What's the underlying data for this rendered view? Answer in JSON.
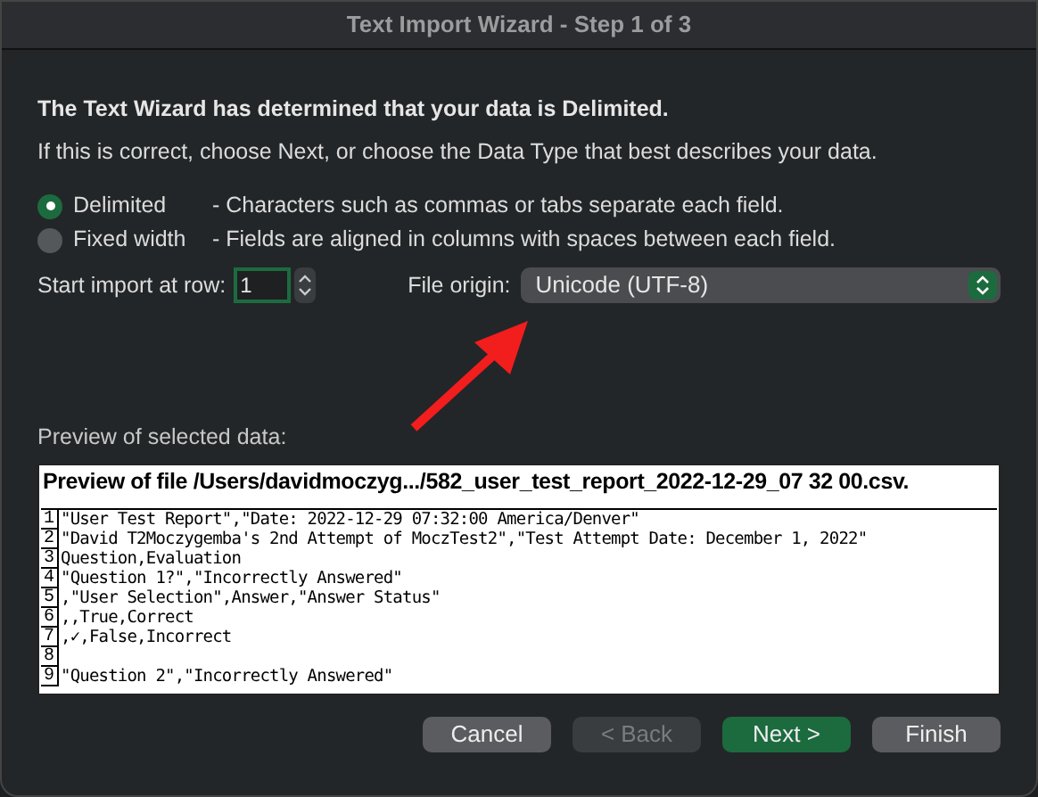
{
  "window": {
    "title": "Text Import Wizard - Step 1 of 3"
  },
  "heading": "The Text Wizard has determined that your data is Delimited.",
  "instruction": "If this is correct, choose Next, or choose the Data Type that best describes your data.",
  "data_types": [
    {
      "label": "Delimited",
      "description": "- Characters such as commas or tabs separate each field.",
      "selected": true
    },
    {
      "label": "Fixed width",
      "description": "- Fields are aligned in columns with spaces between each field.",
      "selected": false
    }
  ],
  "start_row": {
    "label": "Start import at row:",
    "value": "1"
  },
  "file_origin": {
    "label": "File origin:",
    "value": "Unicode (UTF-8)"
  },
  "preview": {
    "label": "Preview of selected data:",
    "title": "Preview of file /Users/davidmoczyg.../582_user_test_report_2022-12-29_07 32 00.csv.",
    "lines": [
      {
        "number": "1",
        "text": "\"User Test Report\",\"Date: 2022-12-29 07:32:00 America/Denver\""
      },
      {
        "number": "2",
        "text": "\"David T2Moczygemba's 2nd Attempt of MoczTest2\",\"Test Attempt Date: December 1, 2022\""
      },
      {
        "number": "3",
        "text": "Question,Evaluation"
      },
      {
        "number": "4",
        "text": "\"Question 1?\",\"Incorrectly Answered\""
      },
      {
        "number": "5",
        "text": ",\"User Selection\",Answer,\"Answer Status\""
      },
      {
        "number": "6",
        "text": ",,True,Correct"
      },
      {
        "number": "7",
        "text": ",✓,False,Incorrect"
      },
      {
        "number": "8"
      },
      {
        "number": "9",
        "text": "\"Question 2\",\"Incorrectly Answered\""
      }
    ]
  },
  "buttons": [
    {
      "label": "Cancel",
      "disabled": false,
      "default": false
    },
    {
      "label": "< Back",
      "disabled": true,
      "default": false
    },
    {
      "label": "Next >",
      "disabled": false,
      "default": true
    },
    {
      "label": "Finish",
      "disabled": false,
      "default": false
    }
  ]
}
